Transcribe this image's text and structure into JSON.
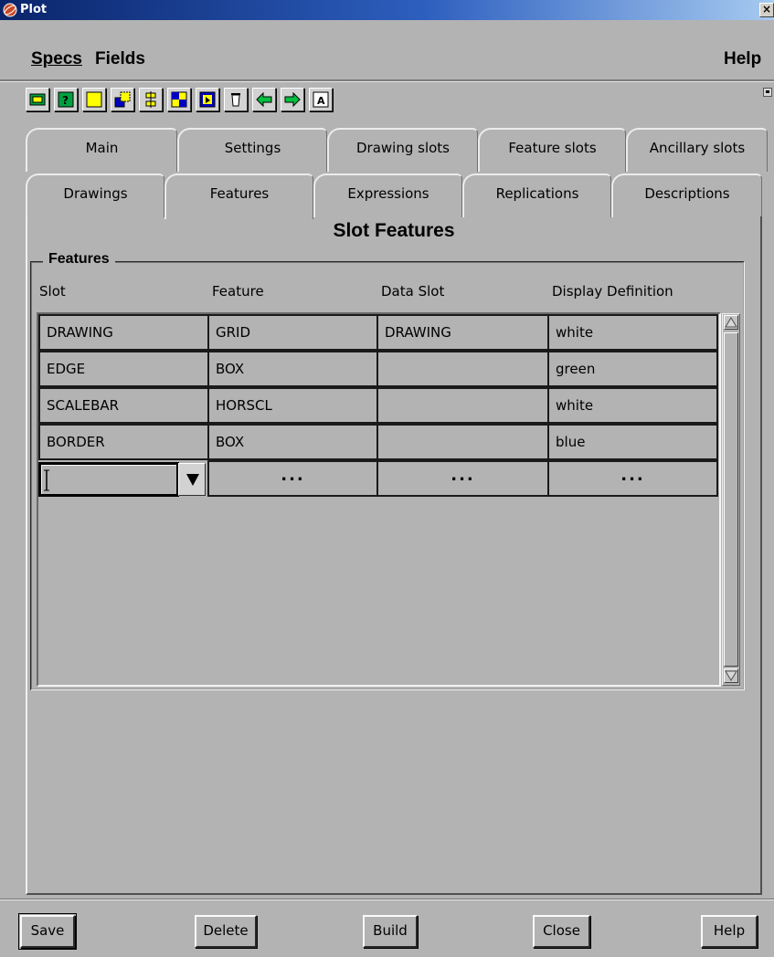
{
  "window": {
    "title": "Plot",
    "close_glyph": "×"
  },
  "menu": {
    "specs": "Specs",
    "fields": "Fields",
    "help": "Help"
  },
  "toolbar": {
    "icons": [
      "open-icon",
      "help-icon",
      "new-icon",
      "copy-icon",
      "align-icon",
      "arrange-icon",
      "select-icon",
      "clear-icon",
      "back-arrow-icon",
      "forward-arrow-icon",
      "text-icon"
    ]
  },
  "tabs": {
    "row1": [
      "Main",
      "Settings",
      "Drawing slots",
      "Feature slots",
      "Ancillary slots"
    ],
    "row2": [
      "Drawings",
      "Features",
      "Expressions",
      "Replications",
      "Descriptions"
    ],
    "active": "Features"
  },
  "panel": {
    "title": "Slot Features",
    "group_label": "Features",
    "columns": [
      "Slot",
      "Feature",
      "Data Slot",
      "Display Definition"
    ],
    "rows": [
      [
        "DRAWING",
        "GRID",
        "DRAWING",
        "white"
      ],
      [
        "EDGE",
        "BOX",
        "",
        "green"
      ],
      [
        "SCALEBAR",
        "HORSCL",
        "",
        "white"
      ],
      [
        "BORDER",
        "BOX",
        "",
        "blue"
      ]
    ],
    "new_row_placeholder": "..."
  },
  "buttons": {
    "save": "Save",
    "delete": "Delete",
    "build": "Build",
    "close": "Close",
    "help": "Help"
  },
  "colors": {
    "background": "#b3b3b3",
    "title_gradient_start": "#0a246a",
    "title_gradient_end": "#a6caf0"
  }
}
